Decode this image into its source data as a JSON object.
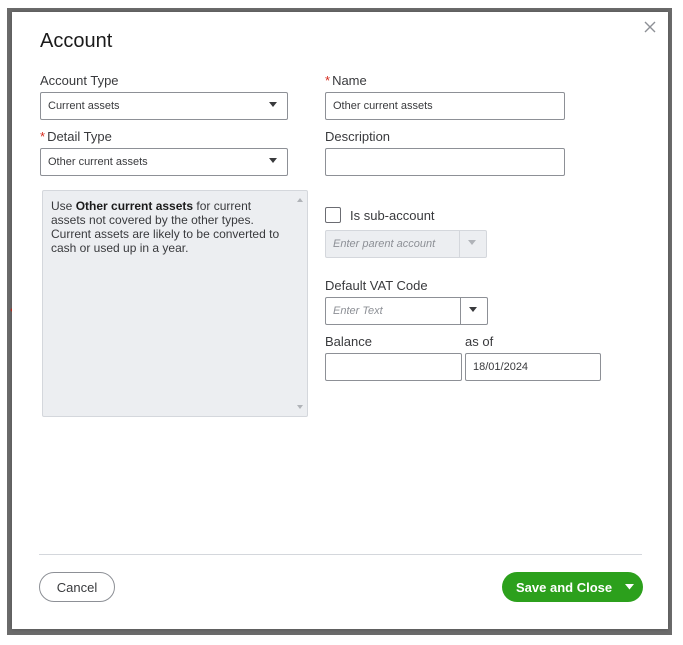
{
  "dialog": {
    "title": "Account",
    "close_icon": "close-icon"
  },
  "account_type": {
    "label": "Account Type",
    "value": "Current assets"
  },
  "name": {
    "label": "Name",
    "required_mark": "*",
    "value": "Other current assets"
  },
  "detail_type": {
    "label": "Detail Type",
    "required_mark": "*",
    "value": "Other current assets"
  },
  "description": {
    "label": "Description",
    "value": ""
  },
  "help_text": {
    "prefix": "Use ",
    "bold": "Other current assets",
    "suffix": " for current assets not covered by the other types. Current assets are likely to be converted to cash or used up in a year."
  },
  "sub_account": {
    "label": "Is sub-account",
    "checked": false,
    "parent_placeholder": "Enter parent account"
  },
  "vat": {
    "label": "Default VAT Code",
    "placeholder": "Enter Text"
  },
  "balance": {
    "label": "Balance",
    "value": "",
    "as_of_label": "as of",
    "as_of_value": "18/01/2024"
  },
  "footer": {
    "cancel_label": "Cancel",
    "save_label": "Save and Close"
  },
  "colors": {
    "primary_green": "#2ca01c",
    "required_red": "#d52b1e",
    "bracket_red": "#d52b1e"
  }
}
